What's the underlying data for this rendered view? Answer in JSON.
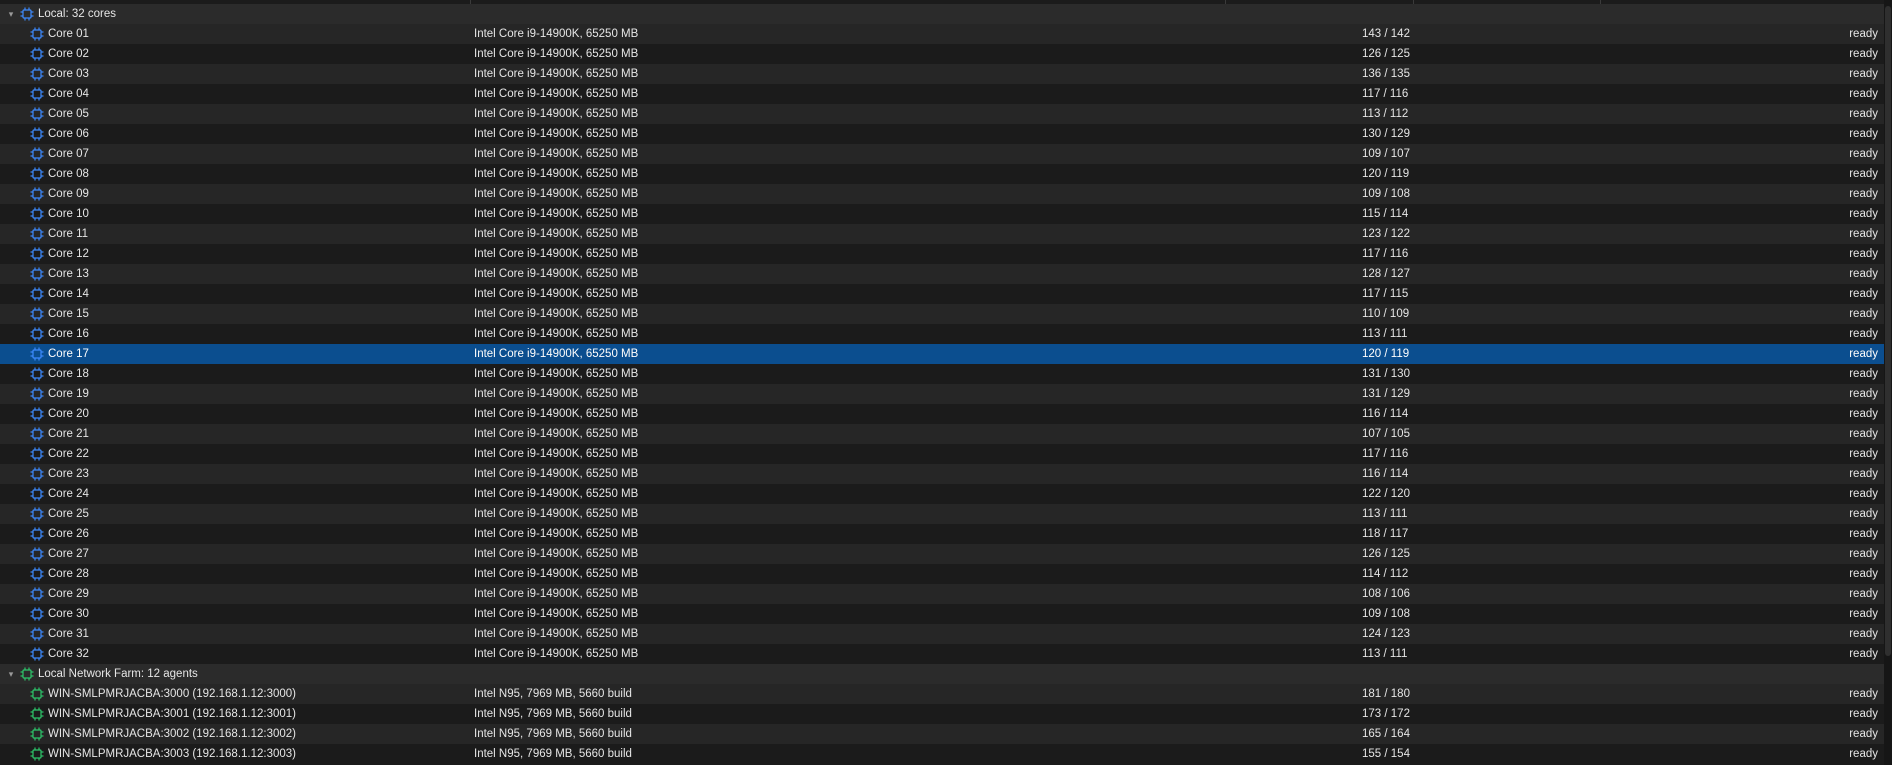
{
  "colors": {
    "background": "#1b1b1b",
    "row_alt": "#262626",
    "selected": "#0b4e8f",
    "local_icon": "#3d8bff",
    "farm_icon": "#2ec66b"
  },
  "groups": [
    {
      "label": "Local: 32 cores",
      "icon": "cpu-chip-icon",
      "rows": [
        {
          "name": "Core 01",
          "desc": "Intel Core i9-14900K, 65250 MB",
          "load": "143 / 142",
          "status": "ready"
        },
        {
          "name": "Core 02",
          "desc": "Intel Core i9-14900K, 65250 MB",
          "load": "126 / 125",
          "status": "ready"
        },
        {
          "name": "Core 03",
          "desc": "Intel Core i9-14900K, 65250 MB",
          "load": "136 / 135",
          "status": "ready"
        },
        {
          "name": "Core 04",
          "desc": "Intel Core i9-14900K, 65250 MB",
          "load": "117 / 116",
          "status": "ready"
        },
        {
          "name": "Core 05",
          "desc": "Intel Core i9-14900K, 65250 MB",
          "load": "113 / 112",
          "status": "ready"
        },
        {
          "name": "Core 06",
          "desc": "Intel Core i9-14900K, 65250 MB",
          "load": "130 / 129",
          "status": "ready"
        },
        {
          "name": "Core 07",
          "desc": "Intel Core i9-14900K, 65250 MB",
          "load": "109 / 107",
          "status": "ready"
        },
        {
          "name": "Core 08",
          "desc": "Intel Core i9-14900K, 65250 MB",
          "load": "120 / 119",
          "status": "ready"
        },
        {
          "name": "Core 09",
          "desc": "Intel Core i9-14900K, 65250 MB",
          "load": "109 / 108",
          "status": "ready"
        },
        {
          "name": "Core 10",
          "desc": "Intel Core i9-14900K, 65250 MB",
          "load": "115 / 114",
          "status": "ready"
        },
        {
          "name": "Core 11",
          "desc": "Intel Core i9-14900K, 65250 MB",
          "load": "123 / 122",
          "status": "ready"
        },
        {
          "name": "Core 12",
          "desc": "Intel Core i9-14900K, 65250 MB",
          "load": "117 / 116",
          "status": "ready"
        },
        {
          "name": "Core 13",
          "desc": "Intel Core i9-14900K, 65250 MB",
          "load": "128 / 127",
          "status": "ready"
        },
        {
          "name": "Core 14",
          "desc": "Intel Core i9-14900K, 65250 MB",
          "load": "117 / 115",
          "status": "ready"
        },
        {
          "name": "Core 15",
          "desc": "Intel Core i9-14900K, 65250 MB",
          "load": "110 / 109",
          "status": "ready"
        },
        {
          "name": "Core 16",
          "desc": "Intel Core i9-14900K, 65250 MB",
          "load": "113 / 111",
          "status": "ready"
        },
        {
          "name": "Core 17",
          "desc": "Intel Core i9-14900K, 65250 MB",
          "load": "120 / 119",
          "status": "ready",
          "selected": true
        },
        {
          "name": "Core 18",
          "desc": "Intel Core i9-14900K, 65250 MB",
          "load": "131 / 130",
          "status": "ready"
        },
        {
          "name": "Core 19",
          "desc": "Intel Core i9-14900K, 65250 MB",
          "load": "131 / 129",
          "status": "ready"
        },
        {
          "name": "Core 20",
          "desc": "Intel Core i9-14900K, 65250 MB",
          "load": "116 / 114",
          "status": "ready"
        },
        {
          "name": "Core 21",
          "desc": "Intel Core i9-14900K, 65250 MB",
          "load": "107 / 105",
          "status": "ready"
        },
        {
          "name": "Core 22",
          "desc": "Intel Core i9-14900K, 65250 MB",
          "load": "117 / 116",
          "status": "ready"
        },
        {
          "name": "Core 23",
          "desc": "Intel Core i9-14900K, 65250 MB",
          "load": "116 / 114",
          "status": "ready"
        },
        {
          "name": "Core 24",
          "desc": "Intel Core i9-14900K, 65250 MB",
          "load": "122 / 120",
          "status": "ready"
        },
        {
          "name": "Core 25",
          "desc": "Intel Core i9-14900K, 65250 MB",
          "load": "113 / 111",
          "status": "ready"
        },
        {
          "name": "Core 26",
          "desc": "Intel Core i9-14900K, 65250 MB",
          "load": "118 / 117",
          "status": "ready"
        },
        {
          "name": "Core 27",
          "desc": "Intel Core i9-14900K, 65250 MB",
          "load": "126 / 125",
          "status": "ready"
        },
        {
          "name": "Core 28",
          "desc": "Intel Core i9-14900K, 65250 MB",
          "load": "114 / 112",
          "status": "ready"
        },
        {
          "name": "Core 29",
          "desc": "Intel Core i9-14900K, 65250 MB",
          "load": "108 / 106",
          "status": "ready"
        },
        {
          "name": "Core 30",
          "desc": "Intel Core i9-14900K, 65250 MB",
          "load": "109 / 108",
          "status": "ready"
        },
        {
          "name": "Core 31",
          "desc": "Intel Core i9-14900K, 65250 MB",
          "load": "124 / 123",
          "status": "ready"
        },
        {
          "name": "Core 32",
          "desc": "Intel Core i9-14900K, 65250 MB",
          "load": "113 / 111",
          "status": "ready"
        }
      ]
    },
    {
      "label": "Local Network Farm: 12 agents",
      "icon": "network-chip-icon",
      "rows": [
        {
          "name": "WIN-SMLPMRJACBA:3000 (192.168.1.12:3000)",
          "desc": "Intel N95, 7969 MB, 5660 build",
          "load": "181 / 180",
          "status": "ready"
        },
        {
          "name": "WIN-SMLPMRJACBA:3001 (192.168.1.12:3001)",
          "desc": "Intel N95, 7969 MB, 5660 build",
          "load": "173 / 172",
          "status": "ready"
        },
        {
          "name": "WIN-SMLPMRJACBA:3002 (192.168.1.12:3002)",
          "desc": "Intel N95, 7969 MB, 5660 build",
          "load": "165 / 164",
          "status": "ready"
        },
        {
          "name": "WIN-SMLPMRJACBA:3003 (192.168.1.12:3003)",
          "desc": "Intel N95, 7969 MB, 5660 build",
          "load": "155 / 154",
          "status": "ready"
        }
      ]
    }
  ]
}
